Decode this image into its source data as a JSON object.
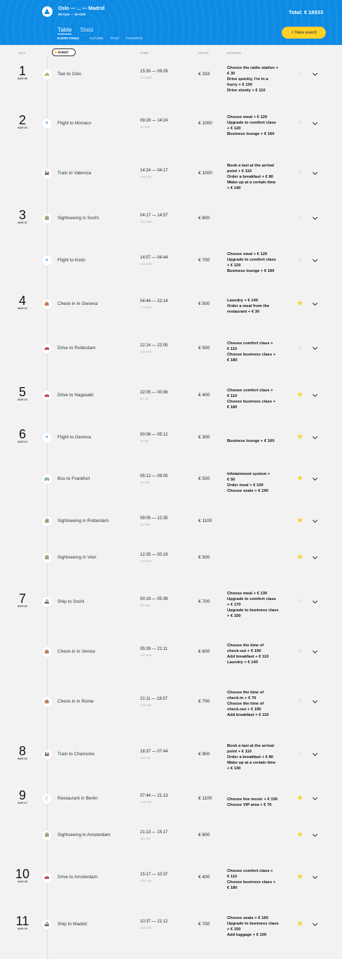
{
  "header": {
    "route": "Oslo — ... — Madrid",
    "dates": "09 AUG — 19 AUG",
    "total": "Total: € 18533",
    "tabs": [
      "Table",
      "Stats"
    ],
    "filters": [
      "EVERYTHING",
      "FUTURE",
      "PAST",
      "FAVORITE"
    ],
    "new_event": "+ New event"
  },
  "columns": {
    "day": "DAY",
    "event": "EVENT",
    "time": "TIME",
    "price": "PRICE",
    "offers": "OFFERS"
  },
  "colors": {
    "header_bg": "#0d8ae4",
    "accent": "#ffd028",
    "page_bg": "#f2f2f2"
  },
  "events": [
    {
      "day": "1",
      "date": "AUG 09",
      "icon": "taxi",
      "title": "Taxi to Oslo",
      "time": "15:30 — 09:29",
      "duration": "17H 59M",
      "price": "€ 333",
      "offers": [
        "Choose the radio station +",
        "€ 30",
        "Drive quickly, I'm in a",
        "hurry + € 100",
        "Drive slowly + € 110"
      ],
      "favorite": false
    },
    {
      "day": "2",
      "date": "AUG 10",
      "icon": "flight",
      "title": "Flight to Monaco",
      "time": "09:29 — 14:24",
      "duration": "4H 54M",
      "price": "€ 1000",
      "offers": [
        "Choose meal + € 120",
        "Upgrade to comfort class",
        "+ € 120",
        "Business lounge + € 160"
      ],
      "favorite": false
    },
    {
      "day": "",
      "date": "",
      "icon": "train",
      "title": "Train to Valencia",
      "time": "14:24 — 04:17",
      "duration": "13H 53M",
      "price": "€ 1000",
      "offers": [
        "Book a taxi at the arrival",
        "point + € 110",
        "Order a breakfast + € 80",
        "Wake up at a certain time",
        "+ € 140"
      ],
      "favorite": false
    },
    {
      "day": "3",
      "date": "AUG 11",
      "icon": "sightseeing",
      "title": "Sightseeing in Sochi",
      "time": "04:17 — 14:57",
      "duration": "10H 40M",
      "price": "€ 800",
      "offers": [],
      "favorite": false
    },
    {
      "day": "",
      "date": "",
      "icon": "flight",
      "title": "Flight to Kioto",
      "time": "14:57 — 04:44",
      "duration": "13H 46M",
      "price": "€ 700",
      "offers": [
        "Choose meal + € 120",
        "Upgrade to comfort class",
        "+ € 120",
        "Business lounge + € 160"
      ],
      "favorite": false
    },
    {
      "day": "4",
      "date": "AUG 12",
      "icon": "check-in",
      "title": "Check-in in Geneva",
      "time": "04:44 — 22:14",
      "duration": "17H 30M",
      "price": "€ 500",
      "offers": [
        "Laundry + € 140",
        "Order a meal from the",
        "restaurant + € 30"
      ],
      "favorite": true
    },
    {
      "day": "",
      "date": "",
      "icon": "drive",
      "title": "Drive to Rotterdam",
      "time": "22:14 — 22:05",
      "duration": "23H 50M",
      "price": "€ 500",
      "offers": [
        "Choose comfort class +",
        "€ 110",
        "Choose business class +",
        "€ 180"
      ],
      "favorite": false
    },
    {
      "day": "5",
      "date": "AUG 13",
      "icon": "drive",
      "title": "Drive to Nagasaki",
      "time": "22:05 — 00:06",
      "duration": "2H 1M",
      "price": "€ 400",
      "offers": [
        "Choose comfort class +",
        "€ 110",
        "Choose business class +",
        "€ 180"
      ],
      "favorite": true
    },
    {
      "day": "6",
      "date": "AUG 14",
      "icon": "flight",
      "title": "Flight to Geneva",
      "time": "00:06 — 05:12",
      "duration": "5H 6M",
      "price": "€ 300",
      "offers": [
        "Business lounge + € 160"
      ],
      "favorite": true
    },
    {
      "day": "",
      "date": "",
      "icon": "bus",
      "title": "Bus to Frankfurt",
      "time": "05:12 — 09:05",
      "duration": "3H 53M",
      "price": "€ 500",
      "offers": [
        "Infotainment system +",
        "€ 50",
        "Order meal + € 100",
        "Choose seats + € 190"
      ],
      "favorite": true
    },
    {
      "day": "",
      "date": "",
      "icon": "sightseeing",
      "title": "Sightseeing in Rotterdam",
      "time": "09:05 — 12:35",
      "duration": "3H 30M",
      "price": "€ 1100",
      "offers": [],
      "favorite": true
    },
    {
      "day": "",
      "date": "",
      "icon": "sightseeing",
      "title": "Sightseeing in Vien",
      "time": "12:35 — 00:19",
      "duration": "11H 43M",
      "price": "€ 500",
      "offers": [],
      "favorite": true
    },
    {
      "day": "7",
      "date": "AUG 16",
      "icon": "ship",
      "title": "Ship to Sochi",
      "time": "00:19 — 05:39",
      "duration": "5H 20M",
      "price": "€ 700",
      "offers": [
        "Choose meal + € 130",
        "Upgrade to comfort class",
        "+ € 170",
        "Upgrade to business class",
        "+ € 150"
      ],
      "favorite": false
    },
    {
      "day": "",
      "date": "",
      "icon": "check-in",
      "title": "Check-in in Venice",
      "time": "05:39 — 21:11",
      "duration": "15H 31M",
      "price": "€ 600",
      "offers": [
        "Choose the time of",
        "check-out + € 190",
        "Add breakfast + € 110",
        "Laundry + € 140"
      ],
      "favorite": false
    },
    {
      "day": "",
      "date": "",
      "icon": "check-in",
      "title": "Check-in in Rome",
      "time": "21:11 — 18:37",
      "duration": "21H 26M",
      "price": "€ 700",
      "offers": [
        "Choose the time of",
        "check-in + € 70",
        "Choose the time of",
        "check-out + € 190",
        "Add breakfast + € 110"
      ],
      "favorite": false
    },
    {
      "day": "8",
      "date": "AUG 16",
      "icon": "train",
      "title": "Train to Chamonix",
      "time": "18:37 — 07:44",
      "duration": "13H 7M",
      "price": "€ 900",
      "offers": [
        "Book a taxi at the arrival",
        "point + € 110",
        "Order a breakfast + € 80",
        "Wake up at a certain time",
        "+ € 140"
      ],
      "favorite": false
    },
    {
      "day": "9",
      "date": "AUG 17",
      "icon": "restaurant",
      "title": "Restaurant in Berlin",
      "time": "07:44 — 21:13",
      "duration": "13H 29M",
      "price": "€ 1100",
      "offers": [
        "Choose live music + € 150",
        "Choose VIP area + € 70"
      ],
      "favorite": true
    },
    {
      "day": "",
      "date": "",
      "icon": "sightseeing",
      "title": "Sightseeing in Amsterdam",
      "time": "21:13 — 15:17",
      "duration": "18H 3M",
      "price": "€ 600",
      "offers": [],
      "favorite": true
    },
    {
      "day": "10",
      "date": "AUG 18",
      "icon": "drive",
      "title": "Drive to Amsterdam",
      "time": "15:17 — 10:37",
      "duration": "19H 19M",
      "price": "€ 400",
      "offers": [
        "Choose comfort class +",
        "€ 110",
        "Choose business class +",
        "€ 180"
      ],
      "favorite": true
    },
    {
      "day": "11",
      "date": "AUG 19",
      "icon": "ship",
      "title": "Ship to Madrid",
      "time": "10:37 — 21:12",
      "duration": "10H 34M",
      "price": "€ 700",
      "offers": [
        "Choose seats + € 160",
        "Upgrade to business class",
        "+ € 150",
        "Add luggage + € 100"
      ],
      "favorite": true
    }
  ]
}
